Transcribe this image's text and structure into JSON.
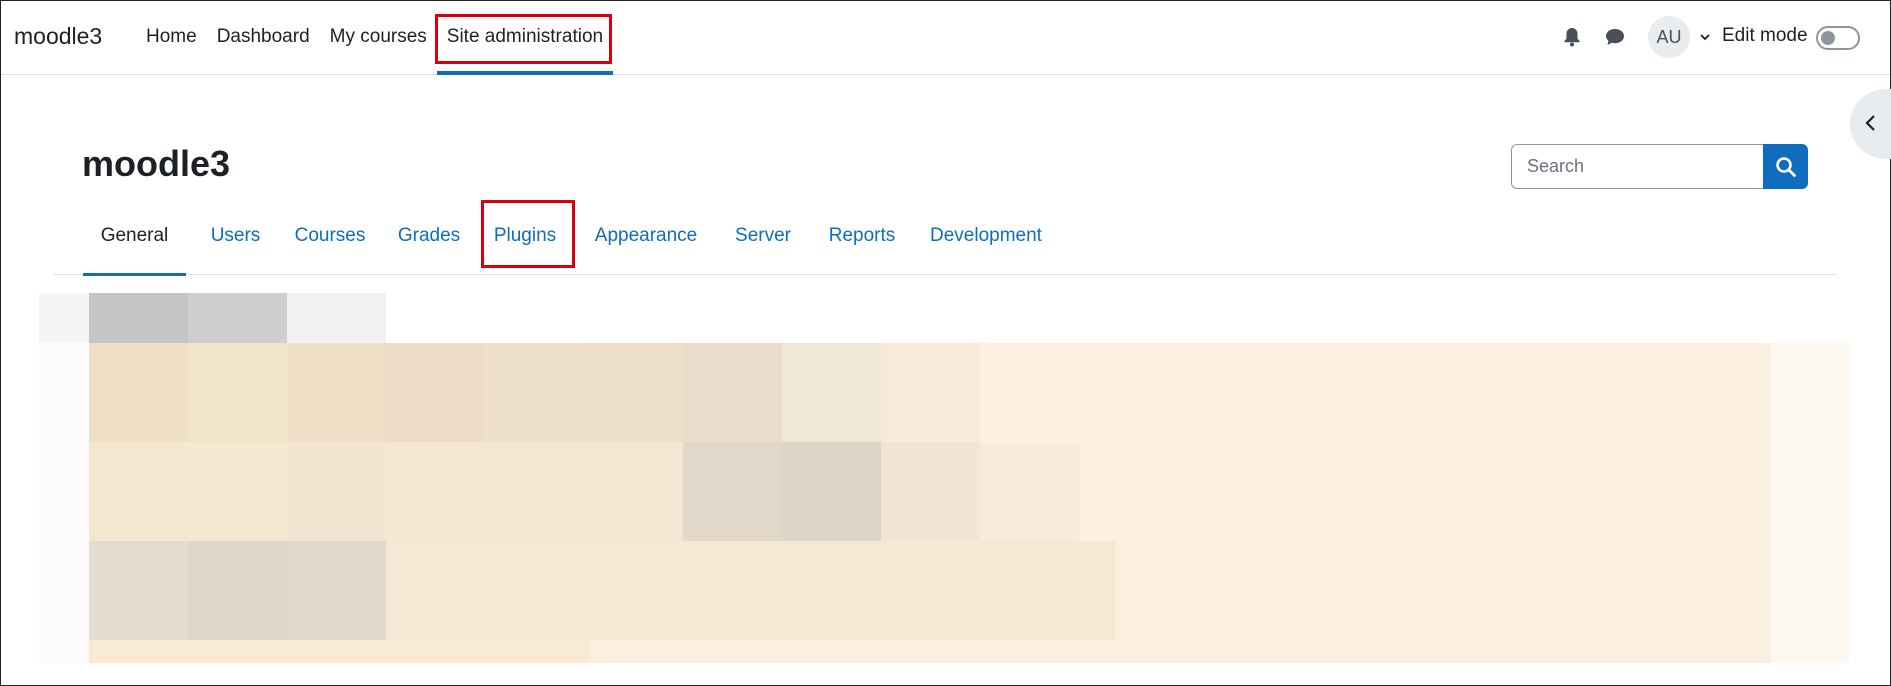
{
  "navbar": {
    "brand": "moodle3",
    "items": [
      {
        "label": "Home"
      },
      {
        "label": "Dashboard"
      },
      {
        "label": "My courses"
      },
      {
        "label": "Site administration"
      }
    ],
    "avatar_initials": "AU",
    "edit_mode_label": "Edit mode"
  },
  "page": {
    "title": "moodle3",
    "search_placeholder": "Search"
  },
  "tabs": [
    {
      "label": "General"
    },
    {
      "label": "Users"
    },
    {
      "label": "Courses"
    },
    {
      "label": "Grades"
    },
    {
      "label": "Plugins"
    },
    {
      "label": "Appearance"
    },
    {
      "label": "Server"
    },
    {
      "label": "Reports"
    },
    {
      "label": "Development"
    }
  ],
  "colors": {
    "accent": "#0f6cbf",
    "highlight": "#d9000d"
  }
}
